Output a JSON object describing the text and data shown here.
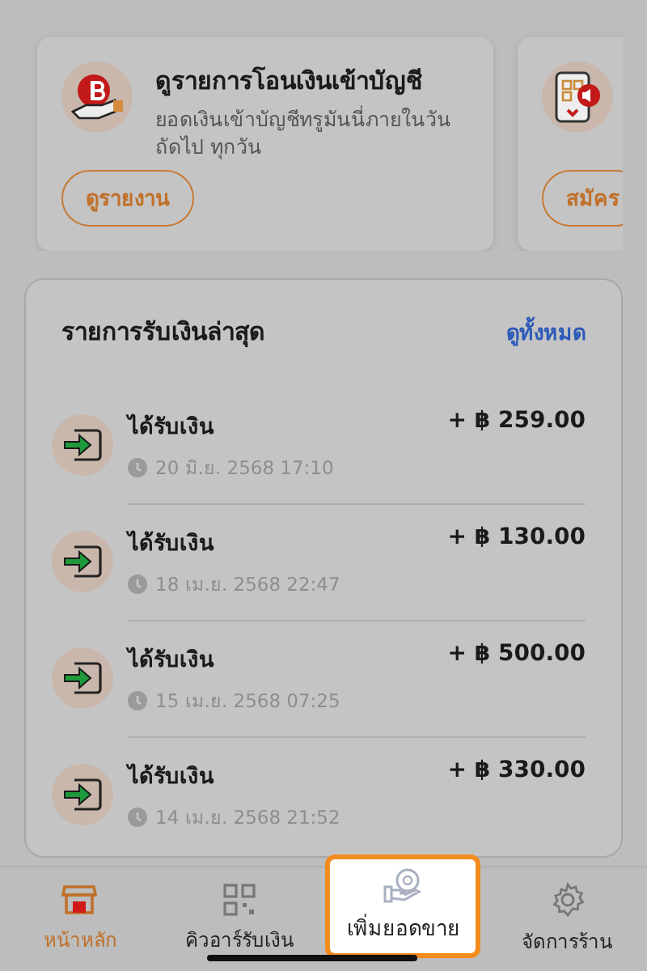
{
  "promo_cards": [
    {
      "kind": "transfer",
      "title": "ดูรายการโอนเงินเข้าบัญชี",
      "description": "ยอดเงินเข้าบัญชีทรูมันนี่ภายในวัน ถัดไป ทุกวัน",
      "button": "ดูรายงาน"
    },
    {
      "kind": "qr",
      "button": "สมัคร"
    }
  ],
  "recent_payments": {
    "title": "รายการรับเงินล่าสุด",
    "link": "ดูทั้งหมด",
    "rows": [
      {
        "label": "ได้รับเงิน",
        "time": "20 มิ.ย. 2568 17:10",
        "amount": "+ ฿ 259.00"
      },
      {
        "label": "ได้รับเงิน",
        "time": "18 เม.ย. 2568 22:47",
        "amount": "+ ฿ 130.00"
      },
      {
        "label": "ได้รับเงิน",
        "time": "15 เม.ย. 2568 07:25",
        "amount": "+ ฿ 500.00"
      },
      {
        "label": "ได้รับเงิน",
        "time": "14 เม.ย. 2568 21:52",
        "amount": "+ ฿ 330.00"
      }
    ]
  },
  "bottom_nav": [
    {
      "kind": "store",
      "label": "หน้าหลัก",
      "selected": true,
      "highlighted": false
    },
    {
      "kind": "qr",
      "label": "คิวอาร์รับเงิน",
      "selected": false,
      "highlighted": false
    },
    {
      "kind": "coin-hand",
      "label": "เพิ่มยอดขาย",
      "selected": false,
      "highlighted": true
    },
    {
      "kind": "gear",
      "label": "จัดการร้าน",
      "selected": false,
      "highlighted": false
    }
  ]
}
